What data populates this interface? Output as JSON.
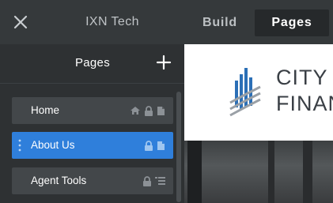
{
  "topbar": {
    "site_title": "IXN Tech",
    "tabs": [
      {
        "label": "Build",
        "active": false
      },
      {
        "label": "Pages",
        "active": true
      }
    ]
  },
  "sidebar": {
    "title": "Pages",
    "items": [
      {
        "label": "Home",
        "active": false,
        "icons": [
          "home-icon",
          "lock-icon",
          "page-icon"
        ]
      },
      {
        "label": "About Us",
        "active": true,
        "icons": [
          "lock-icon",
          "page-icon"
        ]
      },
      {
        "label": "Agent Tools",
        "active": false,
        "icons": [
          "lock-icon",
          "list-icon"
        ]
      }
    ]
  },
  "preview": {
    "logo_lines": [
      "CITY C",
      "FINAN"
    ]
  },
  "colors": {
    "active_item": "#2f7fdb",
    "logo_blue": "#2b6fb6",
    "logo_gray": "#9aa0a6"
  }
}
